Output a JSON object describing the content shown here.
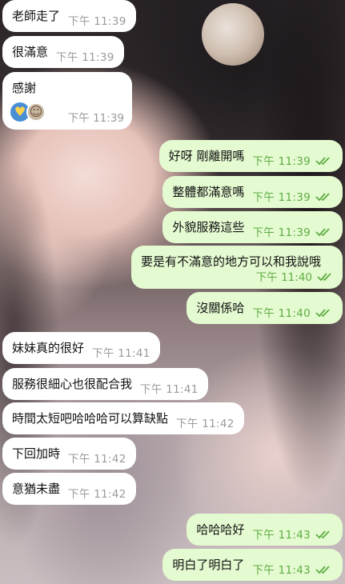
{
  "messages": [
    {
      "side": "in",
      "text": "老師走了",
      "time": "下午 11:39"
    },
    {
      "side": "in",
      "text": "很滿意",
      "time": "下午 11:39"
    },
    {
      "side": "in",
      "text": "感謝",
      "time": "下午 11:39",
      "stickers": [
        "sticker-hearts-emoji",
        "sticker-photo"
      ]
    },
    {
      "side": "out",
      "text": "好呀 剛離開嗎",
      "time": "下午 11:39",
      "status": "read"
    },
    {
      "side": "out",
      "text": "整體都滿意嗎",
      "time": "下午 11:39",
      "status": "read"
    },
    {
      "side": "out",
      "text": "外貌服務這些",
      "time": "下午 11:39",
      "status": "read"
    },
    {
      "side": "out",
      "text": "要是有不滿意的地方可以和我說哦",
      "time": "下午 11:40",
      "status": "read"
    },
    {
      "side": "out",
      "text": "沒關係哈",
      "time": "下午 11:40",
      "status": "read"
    },
    {
      "side": "in",
      "text": "妹妹真的很好",
      "time": "下午 11:41"
    },
    {
      "side": "in",
      "text": "服務很細心也很配合我",
      "time": "下午 11:41"
    },
    {
      "side": "in",
      "text": "時間太短吧哈哈哈可以算缺點",
      "time": "下午 11:42"
    },
    {
      "side": "in",
      "text": "下回加時",
      "time": "下午 11:42"
    },
    {
      "side": "in",
      "text": "意猶未盡",
      "time": "下午 11:42"
    },
    {
      "side": "out",
      "text": "哈哈哈好",
      "time": "下午 11:43",
      "status": "read"
    },
    {
      "side": "out",
      "text": "明白了明白了",
      "time": "下午 11:43",
      "status": "read"
    }
  ],
  "colors": {
    "incoming_bubble": "#ffffff",
    "outgoing_bubble": "#e4fad0",
    "outgoing_meta": "#5fad45",
    "incoming_meta": "#9a9a9a"
  }
}
